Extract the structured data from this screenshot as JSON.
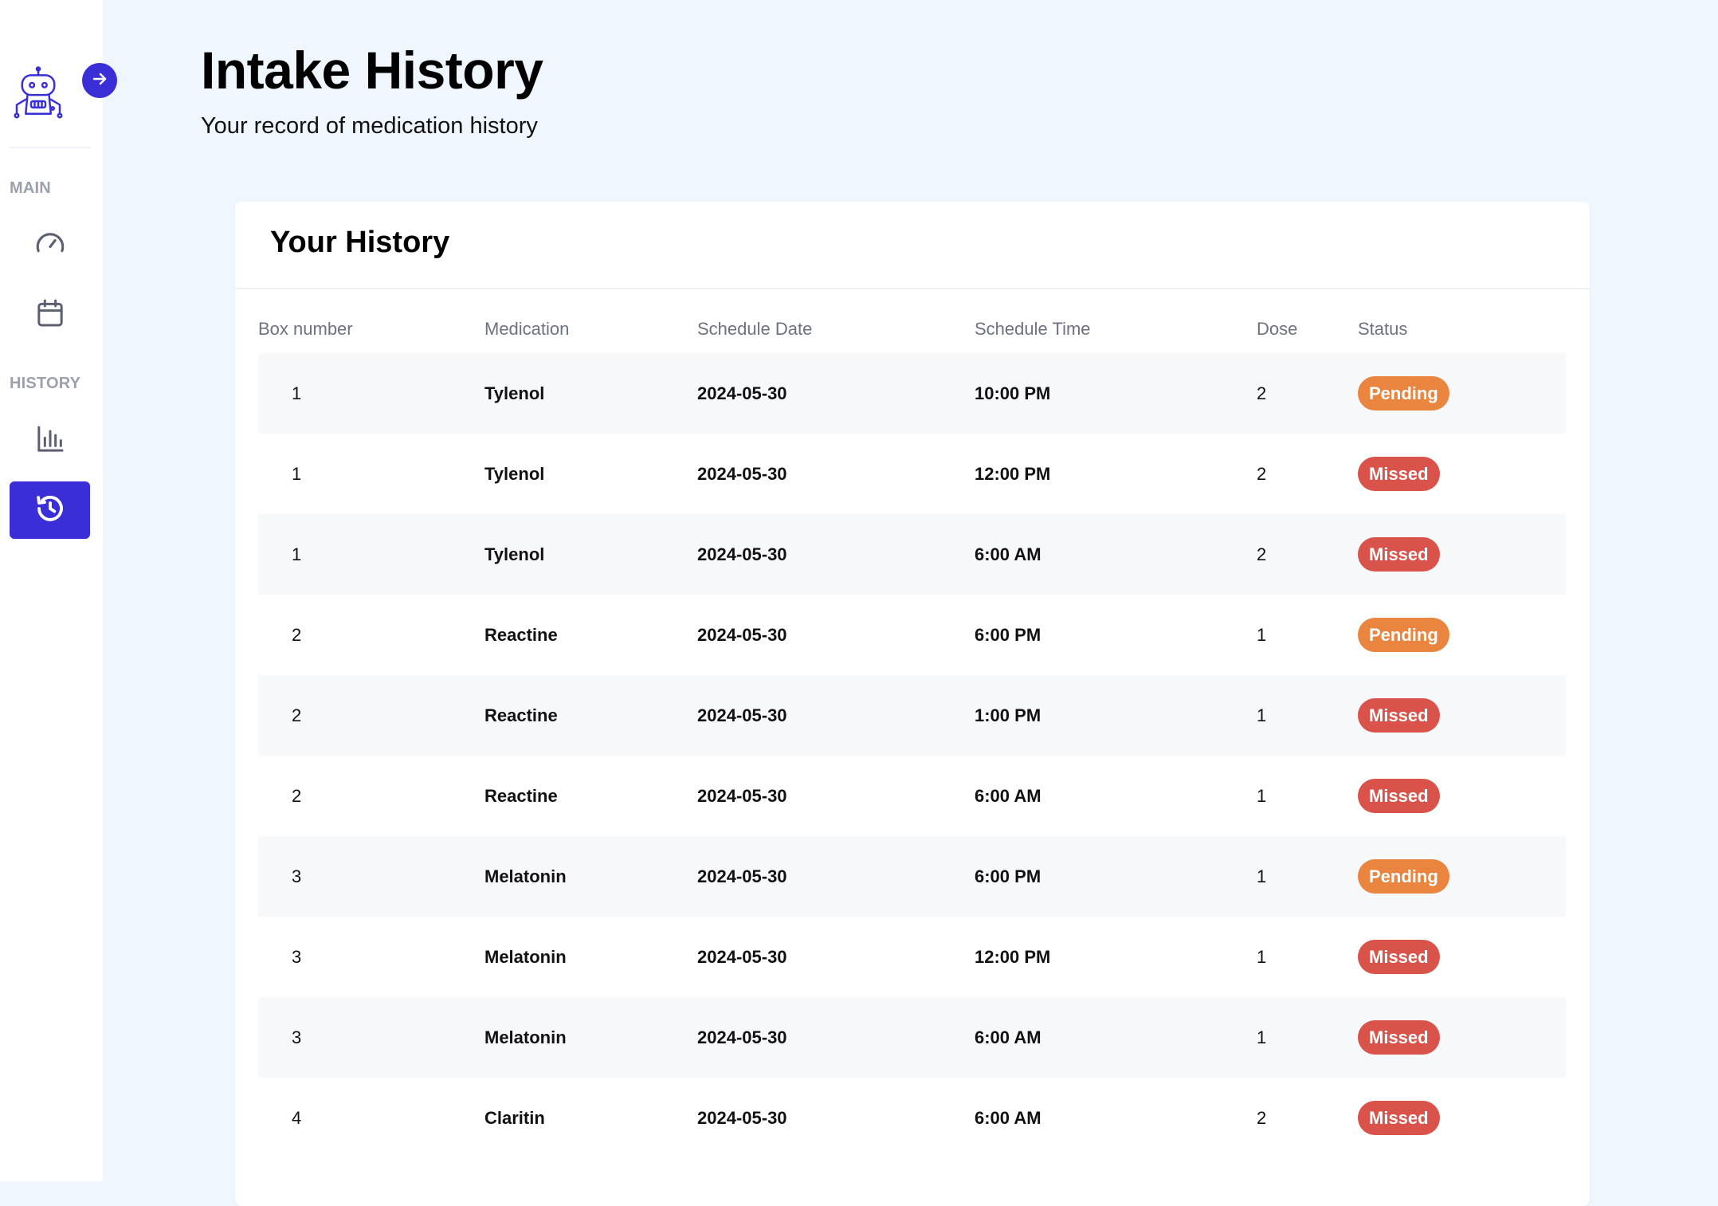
{
  "sidebar": {
    "sections": {
      "main": "MAIN",
      "history": "HISTORY"
    },
    "items": [
      {
        "id": "dashboard",
        "icon": "speedometer-icon",
        "active": false
      },
      {
        "id": "calendar",
        "icon": "calendar-icon",
        "active": false
      },
      {
        "id": "statistics",
        "icon": "bar-chart-icon",
        "active": false
      },
      {
        "id": "intake-history",
        "icon": "history-clock-icon",
        "active": true
      }
    ],
    "logo_icon": "robot-icon",
    "toggle_icon": "arrow-right-icon"
  },
  "header": {
    "title": "Intake History",
    "subtitle": "Your record of medication history"
  },
  "card": {
    "title": "Your History"
  },
  "table": {
    "columns": {
      "box": "Box number",
      "medication": "Medication",
      "date": "Schedule Date",
      "time": "Schedule Time",
      "dose": "Dose",
      "status": "Status"
    },
    "rows": [
      {
        "box": "1",
        "medication": "Tylenol",
        "date": "2024-05-30",
        "time": "10:00 PM",
        "dose": "2",
        "status": "Pending"
      },
      {
        "box": "1",
        "medication": "Tylenol",
        "date": "2024-05-30",
        "time": "12:00 PM",
        "dose": "2",
        "status": "Missed"
      },
      {
        "box": "1",
        "medication": "Tylenol",
        "date": "2024-05-30",
        "time": "6:00 AM",
        "dose": "2",
        "status": "Missed"
      },
      {
        "box": "2",
        "medication": "Reactine",
        "date": "2024-05-30",
        "time": "6:00 PM",
        "dose": "1",
        "status": "Pending"
      },
      {
        "box": "2",
        "medication": "Reactine",
        "date": "2024-05-30",
        "time": "1:00 PM",
        "dose": "1",
        "status": "Missed"
      },
      {
        "box": "2",
        "medication": "Reactine",
        "date": "2024-05-30",
        "time": "6:00 AM",
        "dose": "1",
        "status": "Missed"
      },
      {
        "box": "3",
        "medication": "Melatonin",
        "date": "2024-05-30",
        "time": "6:00 PM",
        "dose": "1",
        "status": "Pending"
      },
      {
        "box": "3",
        "medication": "Melatonin",
        "date": "2024-05-30",
        "time": "12:00 PM",
        "dose": "1",
        "status": "Missed"
      },
      {
        "box": "3",
        "medication": "Melatonin",
        "date": "2024-05-30",
        "time": "6:00 AM",
        "dose": "1",
        "status": "Missed"
      },
      {
        "box": "4",
        "medication": "Claritin",
        "date": "2024-05-30",
        "time": "6:00 AM",
        "dose": "2",
        "status": "Missed"
      }
    ]
  },
  "colors": {
    "accent": "#3a2fd6",
    "pending": "#e9853e",
    "missed": "#d9534a",
    "background": "#eff6fe"
  }
}
